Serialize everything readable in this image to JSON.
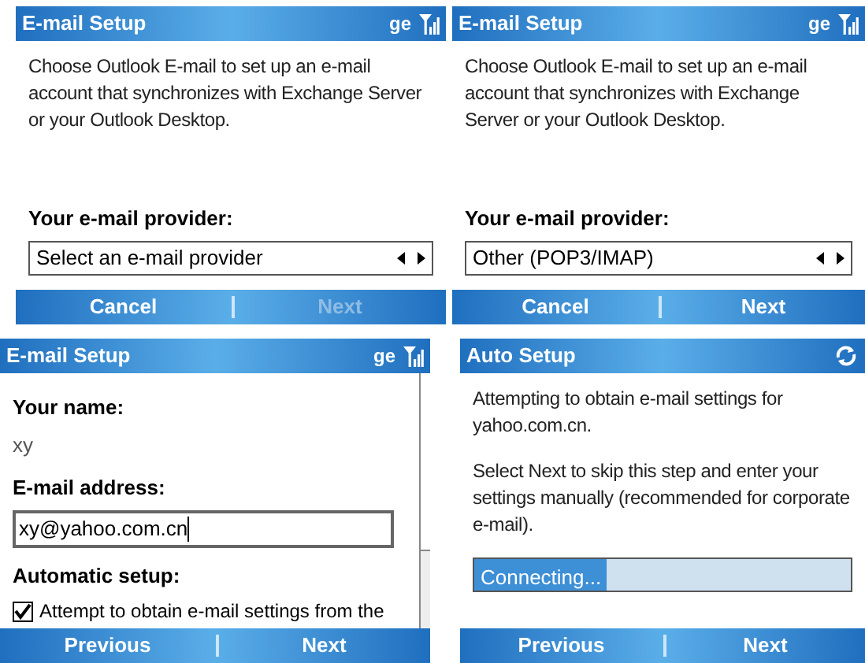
{
  "screens": [
    {
      "title": "E-mail Setup",
      "status": {
        "kind": "signal",
        "text": "ge"
      },
      "scrollbar": false,
      "blocks": [
        {
          "kind": "paragraph",
          "text": "Choose Outlook E-mail to set up an e-mail account that synchronizes with Exchange Server or your Outlook Desktop."
        },
        {
          "kind": "spacer"
        },
        {
          "kind": "label",
          "text": "Your e-mail provider:"
        },
        {
          "kind": "picker",
          "text": "Select an e-mail provider"
        }
      ],
      "softkeys": [
        {
          "label": "Cancel",
          "disabled": false
        },
        {
          "label": "Next",
          "disabled": true
        }
      ]
    },
    {
      "title": "E-mail Setup",
      "status": {
        "kind": "signal",
        "text": "ge"
      },
      "scrollbar": false,
      "blocks": [
        {
          "kind": "paragraph",
          "text": "Choose Outlook E-mail to set up an e-mail account that synchronizes with Exchange Server or your Outlook Desktop."
        },
        {
          "kind": "spacer"
        },
        {
          "kind": "label",
          "text": "Your e-mail provider:"
        },
        {
          "kind": "picker",
          "text": "Other (POP3/IMAP)"
        }
      ],
      "softkeys": [
        {
          "label": "Cancel",
          "disabled": false
        },
        {
          "label": "Next",
          "disabled": false
        }
      ]
    },
    {
      "title": "E-mail Setup",
      "status": {
        "kind": "signal",
        "text": "ge"
      },
      "scrollbar": true,
      "blocks": [
        {
          "kind": "label",
          "text": "Your name:"
        },
        {
          "kind": "value",
          "text": "xy"
        },
        {
          "kind": "label",
          "text": "E-mail address:"
        },
        {
          "kind": "field",
          "text": "xy@yahoo.com.cn"
        },
        {
          "kind": "label",
          "text": "Automatic setup:"
        },
        {
          "kind": "checkbox",
          "text": "Attempt to obtain e-mail settings from the",
          "checked": true
        }
      ],
      "softkeys": [
        {
          "label": "Previous",
          "disabled": false
        },
        {
          "label": "Next",
          "disabled": false
        }
      ]
    },
    {
      "title": "Auto Setup",
      "status": {
        "kind": "sync"
      },
      "scrollbar": false,
      "blocks": [
        {
          "kind": "paragraph",
          "text": "Attempting to obtain e-mail settings for yahoo.com.cn."
        },
        {
          "kind": "paragraph",
          "text": "Select Next to skip this step and enter your settings manually (recommended for corporate e-mail)."
        },
        {
          "kind": "progress",
          "text": "Connecting...",
          "level": 0.35
        }
      ],
      "softkeys": [
        {
          "label": "Previous",
          "disabled": false
        },
        {
          "label": "Next",
          "disabled": false
        }
      ]
    }
  ]
}
